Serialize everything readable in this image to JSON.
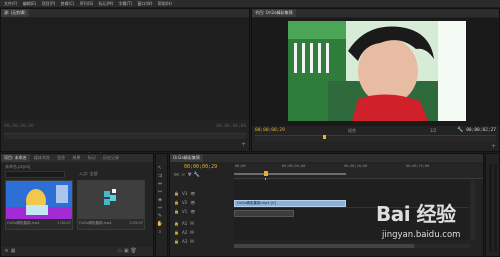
{
  "menu": [
    "文件(F)",
    "编辑(E)",
    "项目(P)",
    "剪辑(C)",
    "序列(S)",
    "标记(M)",
    "字幕(T)",
    "窗口(W)",
    "帮助(H)"
  ],
  "source_monitor": {
    "tab": "源: (无剪辑)",
    "timecode_left": "00;00;00;00",
    "timecode_right": "00;00;00;00"
  },
  "program_monitor": {
    "tab": "节目: Ori2o精彩集锦",
    "timecode_left": "00;00;00;29",
    "fit": "适合",
    "quality": "1/2",
    "timecode_right": "00;00;02;27"
  },
  "project_panel": {
    "tabs": [
      "项目: 未命名",
      "媒体浏览",
      "信息",
      "效果",
      "标记",
      "历史记录"
    ],
    "path": "未命名.prproj",
    "entry": "入点: 全部",
    "items": [
      {
        "name": "Ori2o精彩集锦.mp4",
        "duration": "1:30:07",
        "colors": [
          "#2e6fd6",
          "#c3e8f4",
          "#f1c84b"
        ]
      },
      {
        "name": "Ori2o精彩集锦.mp4",
        "duration": "2:29:07",
        "colors": [
          "#47b7c9",
          "#5bd0e0",
          "#e8f7fb"
        ]
      }
    ]
  },
  "timeline": {
    "tab": "Ori2o精彩集锦",
    "timecode": "00;00;00;29",
    "ruler": [
      "00;00",
      "00;00;05;00",
      "00;00;10;00",
      "00;00;15;00"
    ],
    "tracks": [
      "V3",
      "V2",
      "V1",
      "A1",
      "A2",
      "A3"
    ],
    "clip_label": "Ori2o精彩集锦.mp4 [V]"
  },
  "watermark": {
    "brand": "Bai 经验",
    "url": "jingyan.baidu.com"
  },
  "colors": {
    "accent": "#e7b22f",
    "clip": "#8ab1d8",
    "green_screen": "#2ec24a"
  }
}
